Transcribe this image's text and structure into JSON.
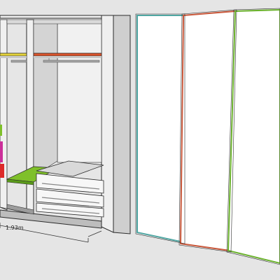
{
  "scene": {
    "background": "#e5e5e5",
    "body_color": "#d8d8d8",
    "body_dark": "#bfbfbf",
    "body_light": "#f3f3f3",
    "interior_color": "#e9e9e9",
    "door_color": "#ffffff",
    "outline_color": "#2b2b2b",
    "rail_color": "#a6a6a6"
  },
  "shelves": {
    "yellow_shelf": "#e4d23a",
    "red_shelf": "#d9532b",
    "green_shelf": "#7fc02a",
    "magenta_item": "#cc2f9a",
    "red_item": "#dd2a2a"
  },
  "doors": [
    {
      "name": "door-left",
      "edge_color": "#4fa6a2"
    },
    {
      "name": "door-middle",
      "edge_color": "#c9573a"
    },
    {
      "name": "door-right",
      "edge_color": "#6bb22d"
    }
  ],
  "dimension": {
    "label": "1.93m",
    "line_color": "#333333"
  }
}
